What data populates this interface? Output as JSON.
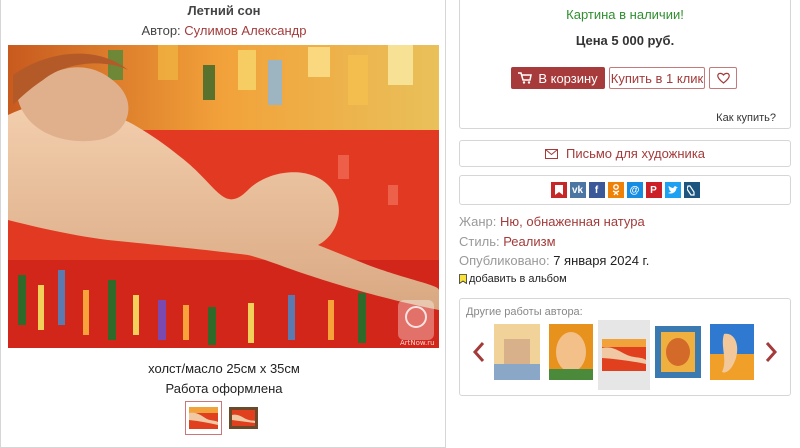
{
  "artwork": {
    "title": "Летний сон",
    "author_label": "Автор:",
    "author_name": "Сулимов Александр",
    "technique": "холст/масло 25см x 35см",
    "framed": "Работа оформлена",
    "watermark": "ArtNow.ru"
  },
  "purchase": {
    "availability": "Картина в наличии!",
    "price": "Цена 5 000 руб.",
    "cart_button": "В корзину",
    "one_click_button": "Купить в 1 клик",
    "how_to_buy": "Как купить?"
  },
  "contact": {
    "letter_button": "Письмо для художника"
  },
  "share": {
    "icons": [
      "bookmark-icon",
      "vk-icon",
      "facebook-icon",
      "odnoklassniki-icon",
      "mail-ru-icon",
      "pinterest-icon",
      "twitter-icon",
      "livejournal-icon"
    ]
  },
  "details": {
    "genre_label": "Жанр:",
    "genre_value": "Ню, обнаженная натура",
    "style_label": "Стиль:",
    "style_value": "Реализм",
    "published_label": "Опубликовано:",
    "published_value": "7 января 2024 г.",
    "add_album": "добавить в альбом"
  },
  "other_works": {
    "title": "Другие работы автора:"
  },
  "colors": {
    "accent": "#a73b3b",
    "in_stock": "#2f8f2f"
  }
}
